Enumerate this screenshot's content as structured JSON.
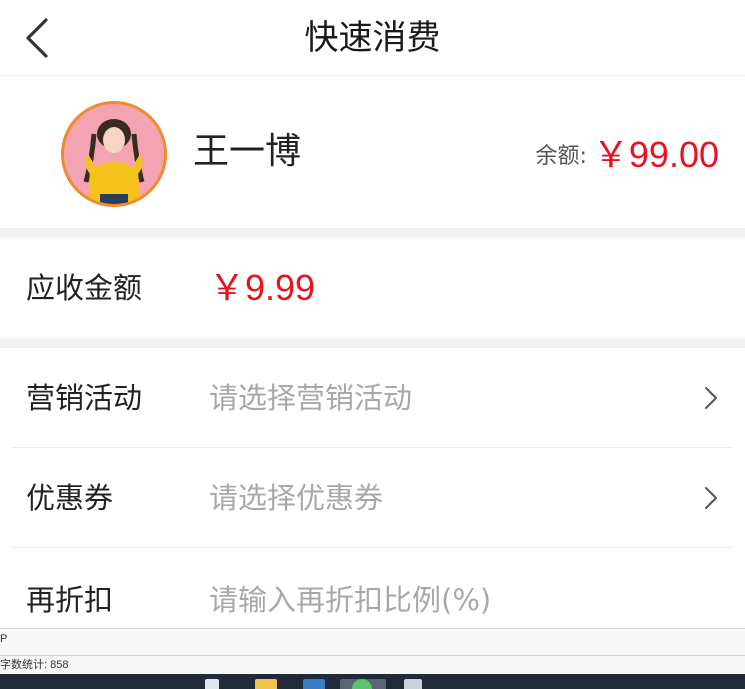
{
  "header": {
    "title": "快速消费",
    "back_icon": "chevron-left-icon"
  },
  "member": {
    "name": "王一博",
    "balance_label": "余额:",
    "balance_value": "￥99.00",
    "avatar_border_color": "#f08a2a"
  },
  "amount": {
    "label": "应收金额",
    "value": "￥9.99"
  },
  "form": {
    "rows": [
      {
        "label": "营销活动",
        "placeholder": "请选择营销活动",
        "icon": "chevron-right-icon"
      },
      {
        "label": "优惠券",
        "placeholder": "请选择优惠券",
        "icon": "chevron-right-icon"
      },
      {
        "label": "再折扣",
        "placeholder": "请输入再折扣比例(%)"
      }
    ]
  },
  "status": {
    "line1": "P",
    "word_count": "字数统计: 858"
  },
  "colors": {
    "accent_red": "#e8141c",
    "placeholder_gray": "#a8a8a8",
    "section_gap": "#f2f2f2"
  }
}
